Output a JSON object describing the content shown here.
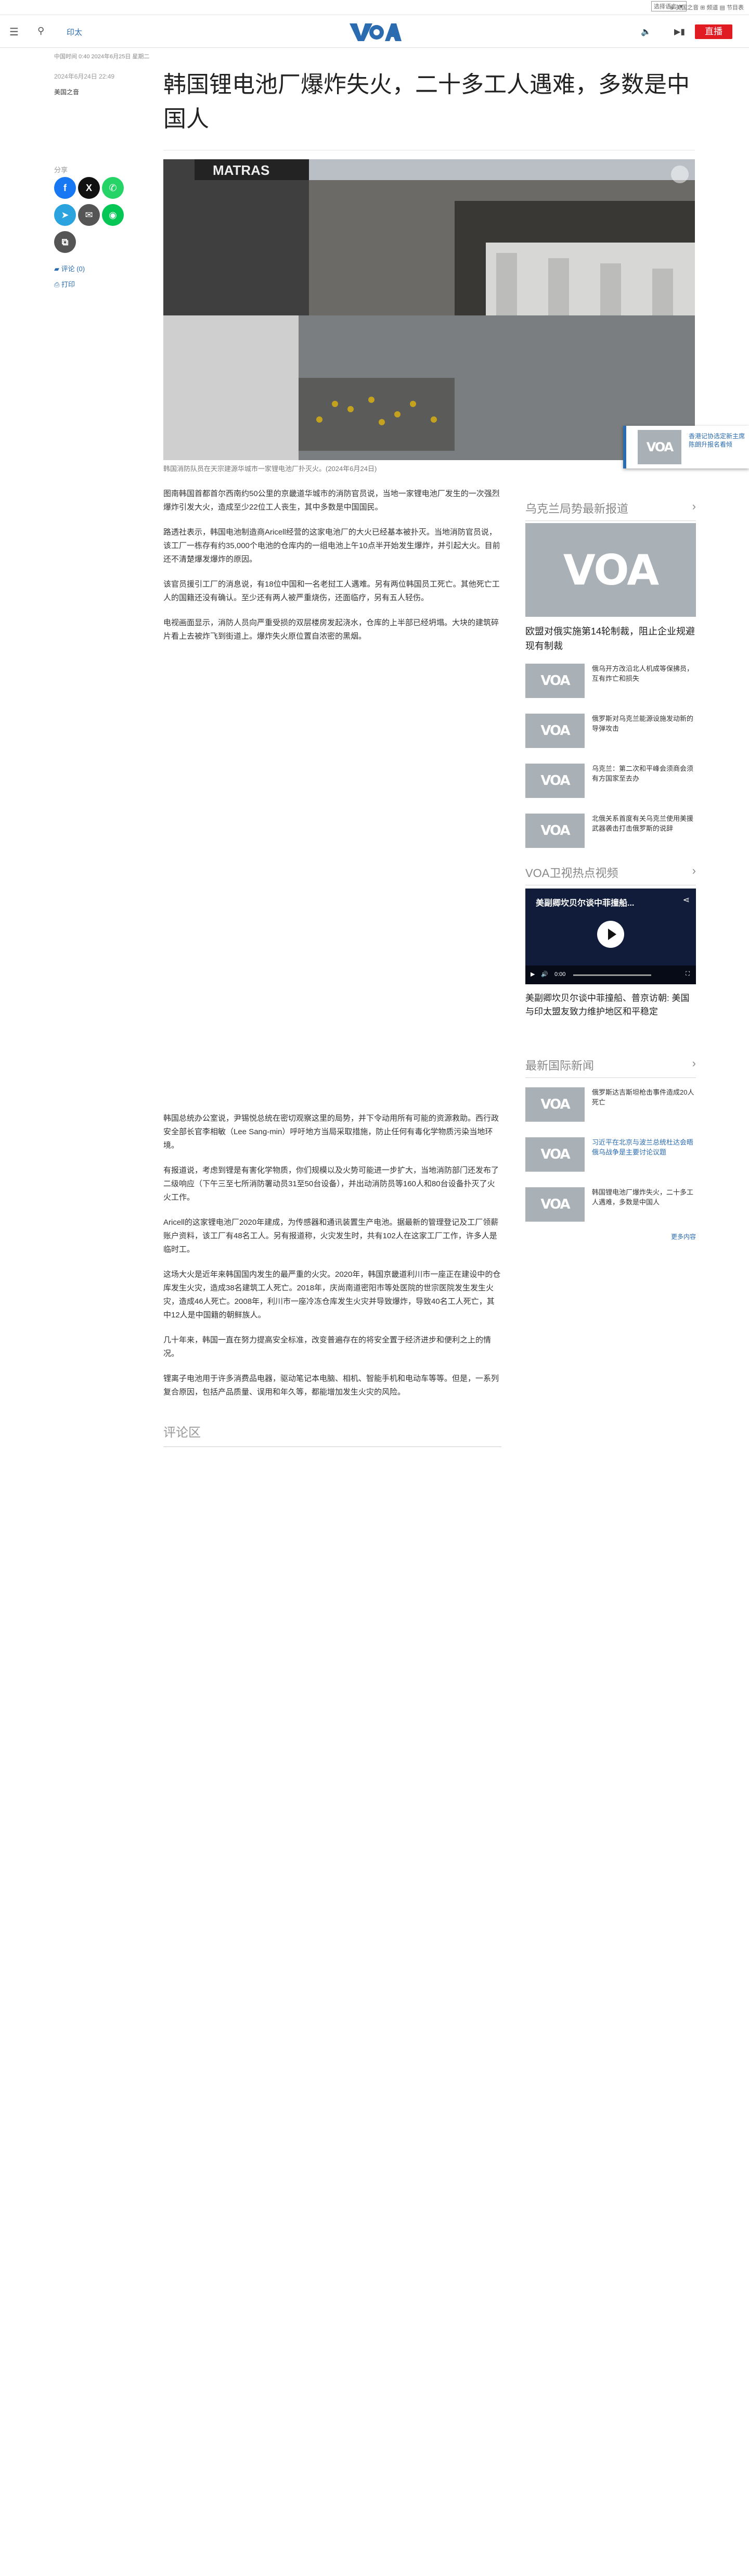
{
  "topbar": {
    "language_select": "选择语言 ▼",
    "links": "⊕ 美国之音 ⊞ 频道 ▤ 节目表"
  },
  "header": {
    "section_label": "印太",
    "live_label": "直播",
    "logo_text": "VOA"
  },
  "article": {
    "breadcrumb": "中国时间 0:40 2024年6月25日 星期二",
    "date": "2024年6月24日 22:49",
    "author": "美国之音",
    "title": "韩国锂电池厂爆炸失火，二十多工人遇难，多数是中国人",
    "share_label": "分享",
    "comment_label": "评论 (0)",
    "print_label": "打印",
    "image_caption": "韩国消防队员在天宗建源华城市一家锂电池厂扑灭火。(2024年6月24日)",
    "paragraphs_part1": [
      "图南韩国首都首尔西南约50公里的京畿道华城市的消防官员说，当地一家锂电池厂发生的一次强烈爆炸引发大火，造成至少22位工人丧生，其中多数是中国国民。",
      "路透社表示，韩国电池制造商Aricell经营的这家电池厂的大火已经基本被扑灭。当地消防官员说，该工厂一栋存有约35,000个电池的仓库内的一组电池上午10点半开始发生爆炸，并引起大火。目前还不清楚爆发爆炸的原因。",
      "该官员援引工厂的消息说，有18位中国和一名老挝工人遇难。另有两位韩国员工死亡。其他死亡工人的国籍还没有确认。至少还有两人被严重烧伤，还面临疗，另有五人轻伤。",
      "电视画面显示，消防人员向严重受损的双层楼房发起浇水，仓库的上半部已经坍塌。大块的建筑碎片看上去被炸飞到街道上。爆炸失火原位置自浓密的黑烟。"
    ],
    "paragraphs_part2": [
      "韩国总统办公室说，尹锡悦总统在密切观察这里的局势，并下令动用所有可能的资源救助。西行政安全部长官李相敏（Lee Sang-min）呼吁地方当局采取措施，防止任何有毒化学物质污染当地环境。",
      "有报道说，考虑到锂是有害化学物质，你们规模以及火势可能进一步扩大，当地消防部门还发布了二级响应（下午三至七所消防署动员31至50台设备），并出动消防员等160人和80台设备扑灭了火火工作。",
      "Aricell的这家锂电池厂2020年建成，为传感器和通讯装置生产电池。据最新的管理登记及工厂领薪账户资料，该工厂有48名工人。另有报道称，火灾发生时，共有102人在这家工厂工作，许多人是临时工。",
      "这场大火是近年来韩国国内发生的最严重的火灾。2020年，韩国京畿道利川市一座正在建设中的仓库发生火灾，造成38名建筑工人死亡。2018年，庆尚南道密阳市等处医院的世宗医院发生发生火灾，造成46人死亡。2008年，利川市一座冷冻仓库发生火灾并导致爆炸，导致40名工人死亡，其中12人是中国籍的朝鲜族人。",
      "几十年来，韩国一直在努力提高安全标准，改变普遍存在的将安全置于经济进步和便利之上的情况。",
      "锂离子电池用于许多消费品电器，驱动笔记本电脑、相机、智能手机和电动车等等。但是，一系列复合原因，包括产品质量、误用和年久等，都能增加发生火灾的风险。"
    ]
  },
  "comments": {
    "heading": "评论区"
  },
  "pip": {
    "text": "香港记协选定新主席陈朗升报名看倾"
  },
  "sidebar": {
    "ukraine": {
      "heading": "乌克兰局势最新报道",
      "lead_title": "欧盟对俄实施第14轮制裁，阻止企业规避现有制裁",
      "items": [
        "俄乌开方改沿北人机成等保拂员，互有炸亡和损失",
        "俄罗斯对乌克兰能源设施发动新的导弹攻击",
        "乌克兰：第二次和平峰会须商会须有方国家至去办",
        "北俄关系首度有关乌克兰使用美援武器袭击打击俄罗斯的说辞"
      ]
    },
    "video": {
      "heading": "VOA卫视热点视频",
      "video_title": "美副卿坎贝尔谈中菲撞船...",
      "time": "0:00",
      "caption": "美副卿坎贝尔谈中菲撞船、普京访朝: 美国与印太盟友致力维护地区和平稳定"
    },
    "intl": {
      "heading": "最新国际新闻",
      "items": [
        "俄罗斯达吉斯坦枪击事件造成20人死亡",
        "习近平在北京与波兰总统杜达会晤 俄乌战争是主要讨论议题",
        "韩国锂电池厂爆炸失火，二十多工人遇难，多数是中国人"
      ],
      "more_label": "更多内容"
    }
  },
  "colors": {
    "accent": "#2b6cb0",
    "live": "#e11b22"
  }
}
